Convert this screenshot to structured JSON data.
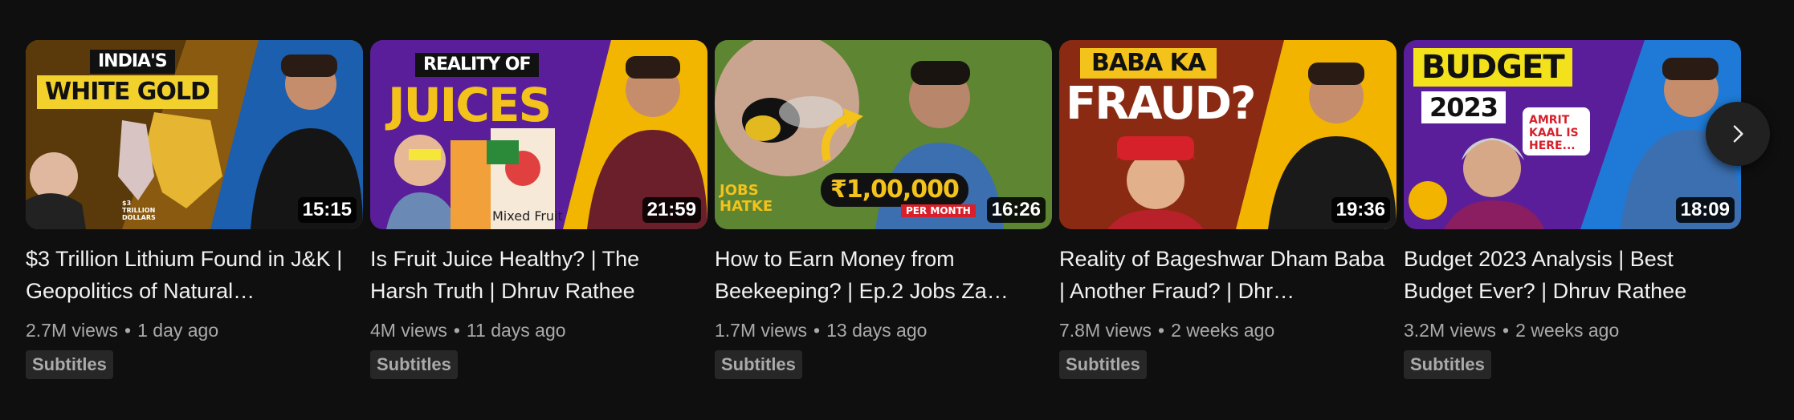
{
  "videos": [
    {
      "title": "$3 Trillion Lithium Found in J&K | Geopolitics of Natural…",
      "views": "2.7M views",
      "age": "1 day ago",
      "badge": "Subtitles",
      "duration": "15:15",
      "thumb_text": {
        "line1": "INDIA'S",
        "line2": "WHITE GOLD",
        "small": "$3 TRILLION DOLLARS"
      }
    },
    {
      "title": "Is Fruit Juice Healthy? | The Harsh Truth | Dhruv Rathee",
      "views": "4M views",
      "age": "11 days ago",
      "badge": "Subtitles",
      "duration": "21:59",
      "thumb_text": {
        "line1": "REALITY OF",
        "line2": "JUICES",
        "small": "Mixed Fruit"
      }
    },
    {
      "title": "How to Earn Money from Beekeeping? | Ep.2 Jobs Za…",
      "views": "1.7M views",
      "age": "13 days ago",
      "badge": "Subtitles",
      "duration": "16:26",
      "thumb_text": {
        "line1": "₹1,00,000",
        "line2": "PER MONTH",
        "small": "JOBS HATKE"
      }
    },
    {
      "title": "Reality of Bageshwar Dham Baba | Another Fraud? | Dhr…",
      "views": "7.8M views",
      "age": "2 weeks ago",
      "badge": "Subtitles",
      "duration": "19:36",
      "thumb_text": {
        "line1": "BABA KA",
        "line2": "FRAUD?"
      }
    },
    {
      "title": "Budget 2023 Analysis | Best Budget Ever? | Dhruv Rathee",
      "views": "3.2M views",
      "age": "2 weeks ago",
      "badge": "Subtitles",
      "duration": "18:09",
      "thumb_text": {
        "line1": "BUDGET",
        "line2": "2023",
        "small": "AMRIT KAAL IS HERE..."
      }
    }
  ],
  "next_button": {
    "icon": "chevron-right-icon"
  }
}
